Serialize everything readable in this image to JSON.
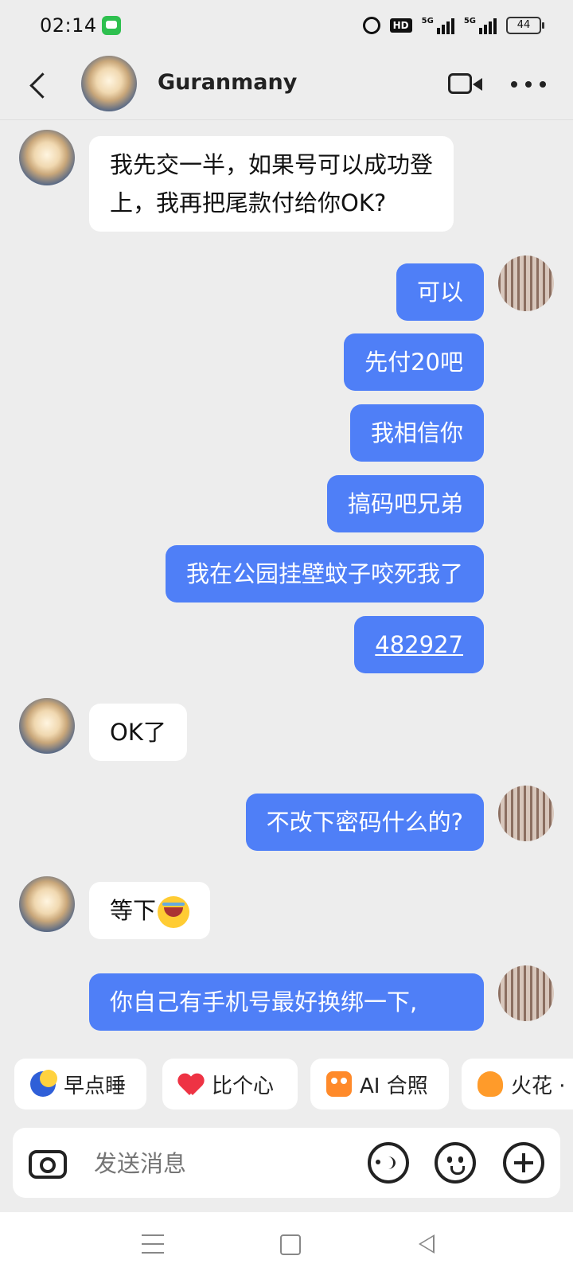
{
  "status_bar": {
    "time": "02:14",
    "hd_label": "HD",
    "network_1": "5G",
    "network_2": "5G",
    "battery": "44"
  },
  "header": {
    "contact_name": "Guranmany"
  },
  "messages": [
    {
      "side": "in",
      "text": "我先交一半，如果号可以成功登"
    },
    {
      "side": "in",
      "text": "上，我再把尾款付给你OK?"
    },
    {
      "side": "out",
      "text": "可以"
    },
    {
      "side": "out",
      "text": "先付20吧"
    },
    {
      "side": "out",
      "text": "我相信你"
    },
    {
      "side": "out",
      "text": "搞码吧兄弟"
    },
    {
      "side": "out",
      "text": "我在公园挂壁蚊子咬死我了"
    },
    {
      "side": "out",
      "text": "482927"
    },
    {
      "side": "in",
      "text": "OK了"
    },
    {
      "side": "out",
      "text": "不改下密码什么的?"
    },
    {
      "side": "in",
      "text": "等下"
    },
    {
      "side": "out",
      "text": "你自己有手机号最好换绑一下,"
    }
  ],
  "quick_replies": [
    {
      "label": "早点睡",
      "icon": "moon-icon"
    },
    {
      "label": "比个心",
      "icon": "heart-icon"
    },
    {
      "label": "AI 合照",
      "icon": "ai-photo-icon"
    },
    {
      "label": "火花 ·",
      "icon": "fire-icon"
    }
  ],
  "input": {
    "placeholder": "发送消息"
  },
  "colors": {
    "outgoing_bubble": "#4f7ff7",
    "incoming_bubble": "#ffffff",
    "background": "#ededed"
  }
}
